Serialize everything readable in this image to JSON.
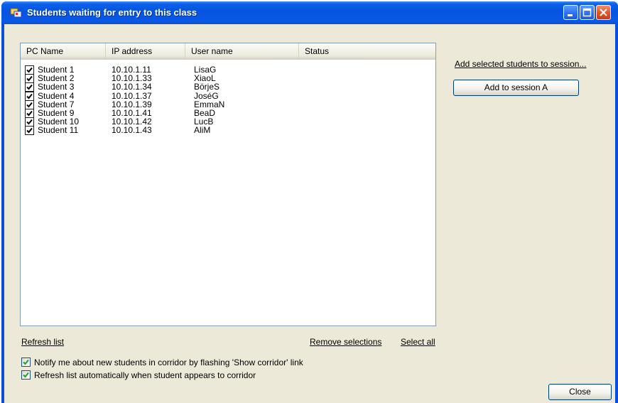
{
  "window": {
    "title": "Students waiting for entry to this class"
  },
  "list": {
    "columns": [
      "PC Name",
      "IP address",
      "User name",
      "Status"
    ],
    "rows": [
      {
        "pc": "Student 1",
        "ip": "10.10.1.11",
        "user": "LisaG",
        "status": "",
        "checked": true
      },
      {
        "pc": "Student 2",
        "ip": "10.10.1.33",
        "user": "XiaoL",
        "status": "",
        "checked": true
      },
      {
        "pc": "Student 3",
        "ip": "10.10.1.34",
        "user": "BörjeS",
        "status": "",
        "checked": true
      },
      {
        "pc": "Student 4",
        "ip": "10.10.1.37",
        "user": "JoséG",
        "status": "",
        "checked": true
      },
      {
        "pc": "Student 7",
        "ip": "10.10.1.39",
        "user": "EmmaN",
        "status": "",
        "checked": true
      },
      {
        "pc": "Student 9",
        "ip": "10.10.1.41",
        "user": "BeaD",
        "status": "",
        "checked": true
      },
      {
        "pc": "Student 10",
        "ip": "10.10.1.42",
        "user": "LucB",
        "status": "",
        "checked": true
      },
      {
        "pc": "Student 11",
        "ip": "10.10.1.43",
        "user": "AliM",
        "status": "",
        "checked": true
      }
    ]
  },
  "links": {
    "refresh": "Refresh list",
    "remove": "Remove selections",
    "select_all": "Select all",
    "add_selected": "Add selected students to session..."
  },
  "buttons": {
    "add_session": "Add to session A",
    "close": "Close"
  },
  "options": {
    "notify": {
      "label": "Notify me about new students in corridor by flashing 'Show corridor' link",
      "checked": true
    },
    "auto_refresh": {
      "label": "Refresh list automatically when student appears to corridor",
      "checked": true
    }
  }
}
